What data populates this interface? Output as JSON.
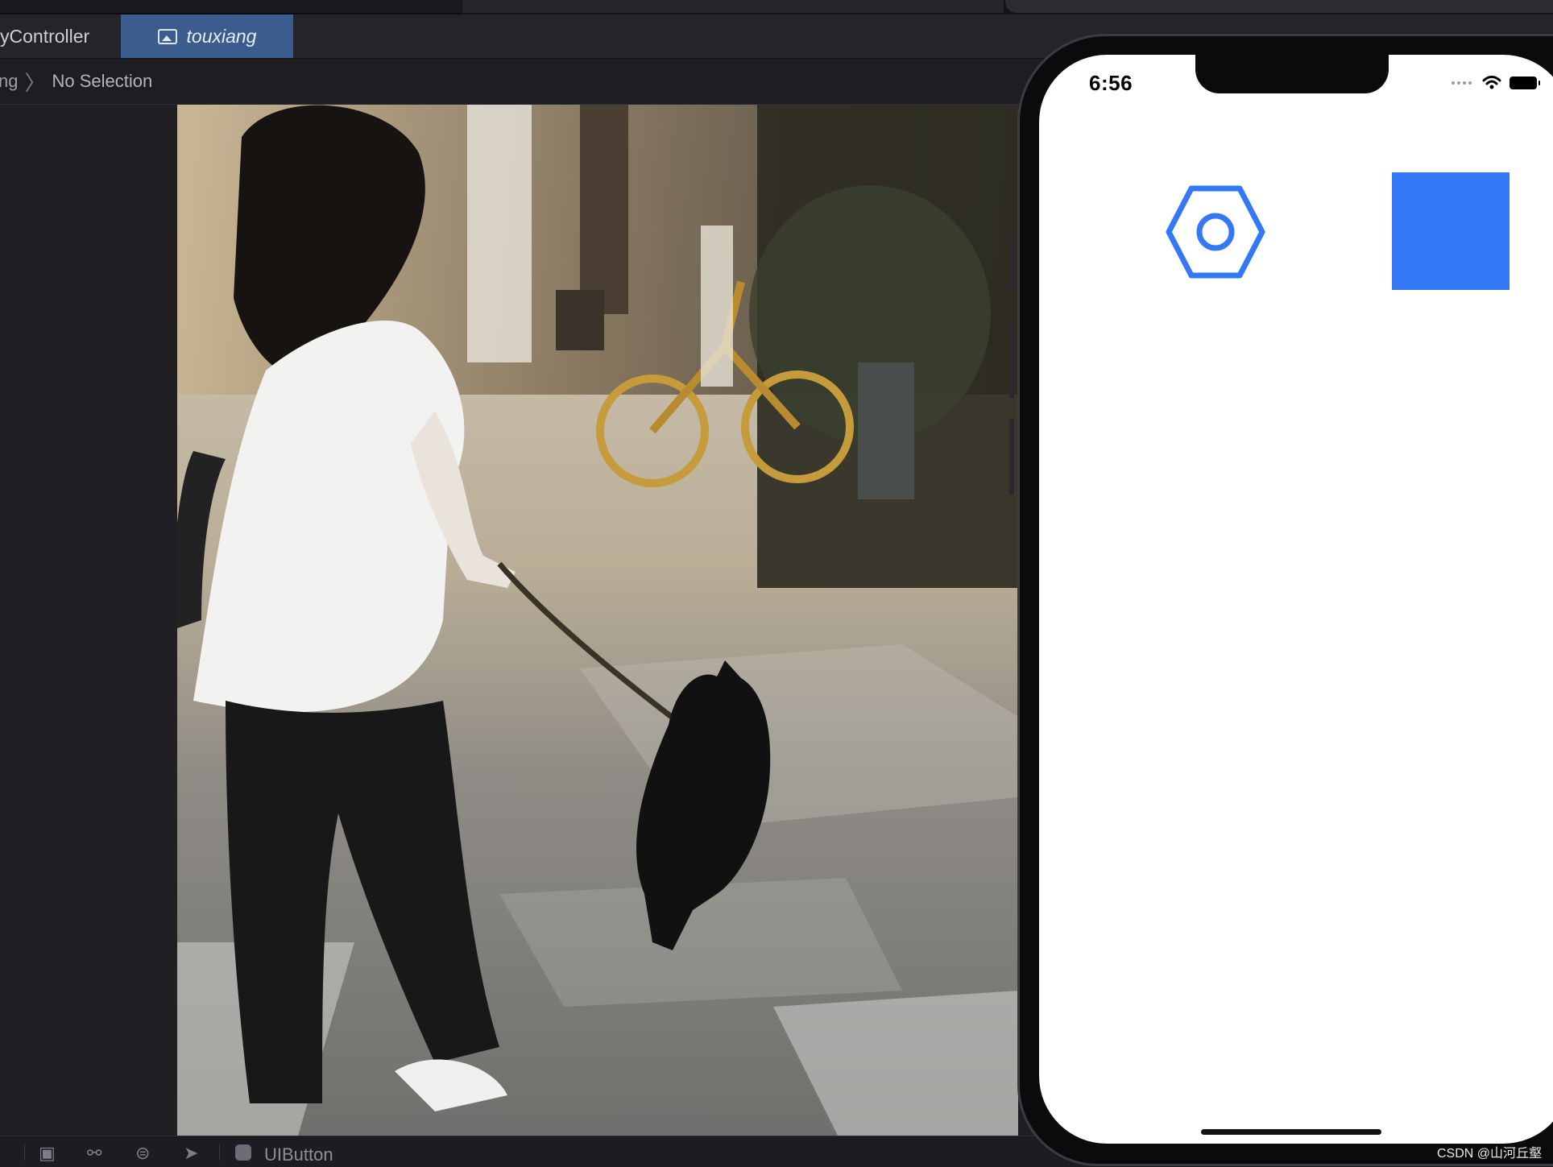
{
  "editor": {
    "tabs": [
      {
        "label": "yController",
        "active": false
      },
      {
        "label": "touxiang",
        "active": true,
        "icon": "image-icon"
      }
    ],
    "jumpbar": {
      "crumb_partial": "ng",
      "selection": "No Selection"
    },
    "bottom_toolbar": {
      "icons": [
        "grid-icon",
        "cube-icon",
        "share-graph-icon",
        "toggle-icon",
        "location-arrow-icon"
      ],
      "selected_class": "UIButton"
    },
    "canvas_image": {
      "name": "touxiang"
    }
  },
  "simulator": {
    "status_bar": {
      "time": "6:56"
    },
    "content": {
      "gear_button_icon": "hexagon-gear-icon",
      "square_color": "#3478f6"
    }
  },
  "accent_color": "#3a5d8e",
  "watermark": "CSDN @山河丘壑"
}
